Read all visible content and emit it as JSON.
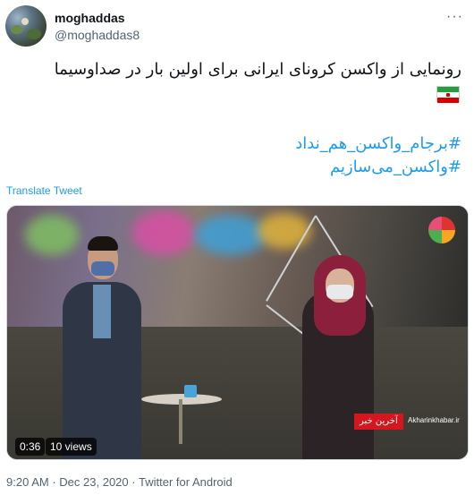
{
  "user": {
    "name": "moghaddas",
    "handle": "@moghaddas8",
    "more_icon": "more-dots-icon"
  },
  "tweet": {
    "text": "رونمایی از واکسن کرونای ایرانی برای اولین بار در صداوسیما",
    "flag_icon": "iran-flag-icon",
    "hashtags": [
      "#برجام_واکسن_هم_نداد",
      "#واکسن_می‌سازیم"
    ],
    "translate_label": "Translate Tweet"
  },
  "video": {
    "duration": "0:36",
    "views": "10 views",
    "ticker_text": "آخرین خبر",
    "ticker_site": "Akharinkhabar.ir"
  },
  "meta": {
    "time": "9:20 AM",
    "separator": "·",
    "date": "Dec 23, 2020",
    "source": "Twitter for Android"
  },
  "colors": {
    "link": "#1d9bf0",
    "secondary_text": "#536471",
    "primary_text": "#0f1419"
  }
}
